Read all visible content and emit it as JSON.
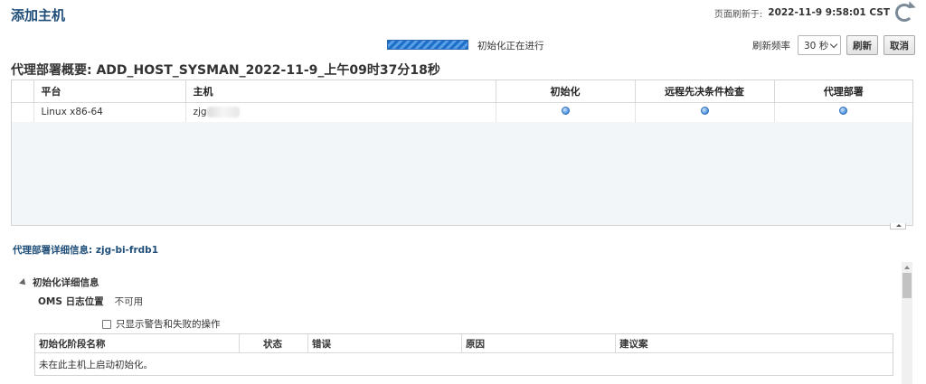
{
  "page": {
    "title": "添加主机",
    "refresh_label": "页面刷新于:",
    "refresh_time": "2022-11-9 9:58:01 CST"
  },
  "progress": {
    "text": "初始化正在进行",
    "value": 1.0
  },
  "toolbar": {
    "frequency_label": "刷新频率",
    "frequency_value": "30 秒",
    "refresh_button": "刷新",
    "cancel_button": "取消"
  },
  "summary": {
    "title": "代理部署概要: ADD_HOST_SYSMAN_2022-11-9_上午09时37分18秒",
    "columns": [
      "平台",
      "主机",
      "初始化",
      "远程先决条件检查",
      "代理部署"
    ],
    "rows": [
      {
        "platform": "Linux x86-64",
        "host": "zjg",
        "init_status": "in-progress-icon",
        "prereq_status": "in-progress-icon",
        "deploy_status": "in-progress-icon"
      }
    ]
  },
  "details": {
    "title": "代理部署详细信息: zjg-bi-frdb1",
    "section_title": "初始化详细信息",
    "oms_label": "OMS 日志位置",
    "oms_value": "不可用",
    "filter_checkbox_label": "只显示警告和失败的操作",
    "filter_checked": false,
    "stage_columns": [
      "初始化阶段名称",
      "状态",
      "错误",
      "原因",
      "建议案"
    ],
    "stage_message": "未在此主机上启动初始化。"
  },
  "colors": {
    "title": "#1f4e79",
    "progress": "#1f6fc8",
    "status_dot": "#4a8fdb"
  }
}
